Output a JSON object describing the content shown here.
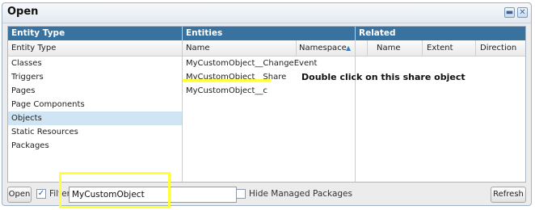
{
  "dialog": {
    "title": "Open"
  },
  "window_buttons": {
    "minimize_icon": "minimize-icon",
    "close_icon": "close-icon"
  },
  "panes": {
    "entity_type": {
      "header": "Entity Type",
      "column": "Entity Type",
      "items": [
        "Classes",
        "Triggers",
        "Pages",
        "Page Components",
        "Objects",
        "Static Resources",
        "Packages"
      ],
      "selected": "Objects"
    },
    "entities": {
      "header": "Entities",
      "columns": {
        "name": "Name",
        "namespace": "Namespace"
      },
      "sort_icon": "sort-ascending-icon",
      "items": [
        "MyCustomObject__ChangeEvent",
        "MyCustomObject__Share",
        "MyCustomObject__c"
      ]
    },
    "related": {
      "header": "Related",
      "columns": {
        "name": "Name",
        "extent": "Extent",
        "direction": "Direction"
      }
    }
  },
  "bottom_bar": {
    "open_label": "Open",
    "filter_label": "Filter",
    "filter_checked": true,
    "filter_value": "MyCustomObject",
    "hide_managed_label": "Hide Managed Packages",
    "hide_managed_checked": false,
    "refresh_label": "Refresh"
  },
  "annotation": {
    "text": "Double click on this share object",
    "highlight_color": "#ffff3a"
  }
}
